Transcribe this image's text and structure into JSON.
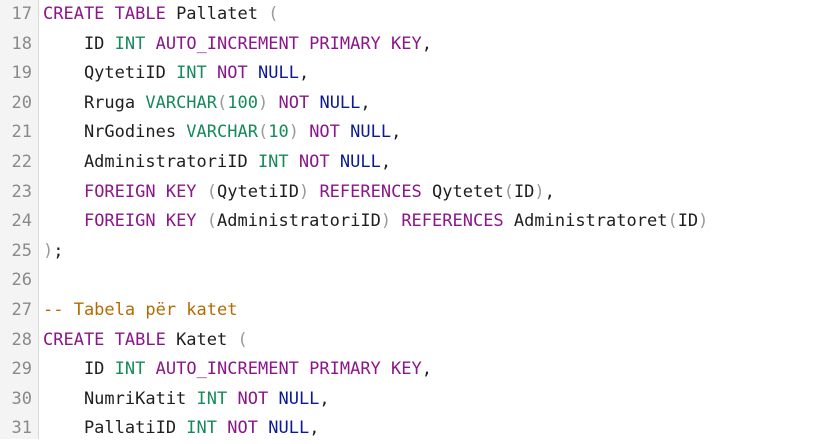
{
  "editor": {
    "lines": [
      {
        "number": "17",
        "tokens": [
          {
            "t": "CREATE TABLE",
            "c": "kw"
          },
          {
            "t": " Pallatet ",
            "c": "id"
          },
          {
            "t": "(",
            "c": "pa"
          }
        ]
      },
      {
        "number": "18",
        "tokens": [
          {
            "t": "    ID ",
            "c": "id"
          },
          {
            "t": "INT",
            "c": "ty"
          },
          {
            "t": " ",
            "c": "id"
          },
          {
            "t": "AUTO_INCREMENT PRIMARY KEY",
            "c": "kw"
          },
          {
            "t": ",",
            "c": "id"
          }
        ]
      },
      {
        "number": "19",
        "tokens": [
          {
            "t": "    QytetiID ",
            "c": "id"
          },
          {
            "t": "INT",
            "c": "ty"
          },
          {
            "t": " ",
            "c": "id"
          },
          {
            "t": "NOT",
            "c": "kw"
          },
          {
            "t": " ",
            "c": "id"
          },
          {
            "t": "NULL",
            "c": "nu"
          },
          {
            "t": ",",
            "c": "id"
          }
        ]
      },
      {
        "number": "20",
        "tokens": [
          {
            "t": "    Rruga ",
            "c": "id"
          },
          {
            "t": "VARCHAR",
            "c": "ty"
          },
          {
            "t": "(",
            "c": "pa"
          },
          {
            "t": "100",
            "c": "ty"
          },
          {
            "t": ")",
            "c": "pa"
          },
          {
            "t": " ",
            "c": "id"
          },
          {
            "t": "NOT",
            "c": "kw"
          },
          {
            "t": " ",
            "c": "id"
          },
          {
            "t": "NULL",
            "c": "nu"
          },
          {
            "t": ",",
            "c": "id"
          }
        ]
      },
      {
        "number": "21",
        "tokens": [
          {
            "t": "    NrGodines ",
            "c": "id"
          },
          {
            "t": "VARCHAR",
            "c": "ty"
          },
          {
            "t": "(",
            "c": "pa"
          },
          {
            "t": "10",
            "c": "ty"
          },
          {
            "t": ")",
            "c": "pa"
          },
          {
            "t": " ",
            "c": "id"
          },
          {
            "t": "NOT",
            "c": "kw"
          },
          {
            "t": " ",
            "c": "id"
          },
          {
            "t": "NULL",
            "c": "nu"
          },
          {
            "t": ",",
            "c": "id"
          }
        ]
      },
      {
        "number": "22",
        "tokens": [
          {
            "t": "    AdministratoriID ",
            "c": "id"
          },
          {
            "t": "INT",
            "c": "ty"
          },
          {
            "t": " ",
            "c": "id"
          },
          {
            "t": "NOT",
            "c": "kw"
          },
          {
            "t": " ",
            "c": "id"
          },
          {
            "t": "NULL",
            "c": "nu"
          },
          {
            "t": ",",
            "c": "id"
          }
        ]
      },
      {
        "number": "23",
        "tokens": [
          {
            "t": "    ",
            "c": "id"
          },
          {
            "t": "FOREIGN KEY",
            "c": "kw"
          },
          {
            "t": " ",
            "c": "id"
          },
          {
            "t": "(",
            "c": "pa"
          },
          {
            "t": "QytetiID",
            "c": "id"
          },
          {
            "t": ")",
            "c": "pa"
          },
          {
            "t": " ",
            "c": "id"
          },
          {
            "t": "REFERENCES",
            "c": "kw"
          },
          {
            "t": " Qytetet",
            "c": "id"
          },
          {
            "t": "(",
            "c": "pa"
          },
          {
            "t": "ID",
            "c": "id"
          },
          {
            "t": ")",
            "c": "pa"
          },
          {
            "t": ",",
            "c": "id"
          }
        ]
      },
      {
        "number": "24",
        "tokens": [
          {
            "t": "    ",
            "c": "id"
          },
          {
            "t": "FOREIGN KEY",
            "c": "kw"
          },
          {
            "t": " ",
            "c": "id"
          },
          {
            "t": "(",
            "c": "pa"
          },
          {
            "t": "AdministratoriID",
            "c": "id"
          },
          {
            "t": ")",
            "c": "pa"
          },
          {
            "t": " ",
            "c": "id"
          },
          {
            "t": "REFERENCES",
            "c": "kw"
          },
          {
            "t": " Administratoret",
            "c": "id"
          },
          {
            "t": "(",
            "c": "pa"
          },
          {
            "t": "ID",
            "c": "id"
          },
          {
            "t": ")",
            "c": "pa"
          }
        ]
      },
      {
        "number": "25",
        "tokens": [
          {
            "t": ")",
            "c": "pa"
          },
          {
            "t": ";",
            "c": "id"
          }
        ]
      },
      {
        "number": "26",
        "tokens": []
      },
      {
        "number": "27",
        "tokens": [
          {
            "t": "-- Tabela për katet",
            "c": "cm"
          }
        ]
      },
      {
        "number": "28",
        "tokens": [
          {
            "t": "CREATE TABLE",
            "c": "kw"
          },
          {
            "t": " Katet ",
            "c": "id"
          },
          {
            "t": "(",
            "c": "pa"
          }
        ]
      },
      {
        "number": "29",
        "tokens": [
          {
            "t": "    ID ",
            "c": "id"
          },
          {
            "t": "INT",
            "c": "ty"
          },
          {
            "t": " ",
            "c": "id"
          },
          {
            "t": "AUTO_INCREMENT PRIMARY KEY",
            "c": "kw"
          },
          {
            "t": ",",
            "c": "id"
          }
        ]
      },
      {
        "number": "30",
        "tokens": [
          {
            "t": "    NumriKatit ",
            "c": "id"
          },
          {
            "t": "INT",
            "c": "ty"
          },
          {
            "t": " ",
            "c": "id"
          },
          {
            "t": "NOT",
            "c": "kw"
          },
          {
            "t": " ",
            "c": "id"
          },
          {
            "t": "NULL",
            "c": "nu"
          },
          {
            "t": ",",
            "c": "id"
          }
        ]
      },
      {
        "number": "31",
        "tokens": [
          {
            "t": "    PallatiID ",
            "c": "id"
          },
          {
            "t": "INT",
            "c": "ty"
          },
          {
            "t": " ",
            "c": "id"
          },
          {
            "t": "NOT",
            "c": "kw"
          },
          {
            "t": " ",
            "c": "id"
          },
          {
            "t": "NULL",
            "c": "nu"
          },
          {
            "t": ",",
            "c": "id"
          }
        ]
      }
    ]
  }
}
